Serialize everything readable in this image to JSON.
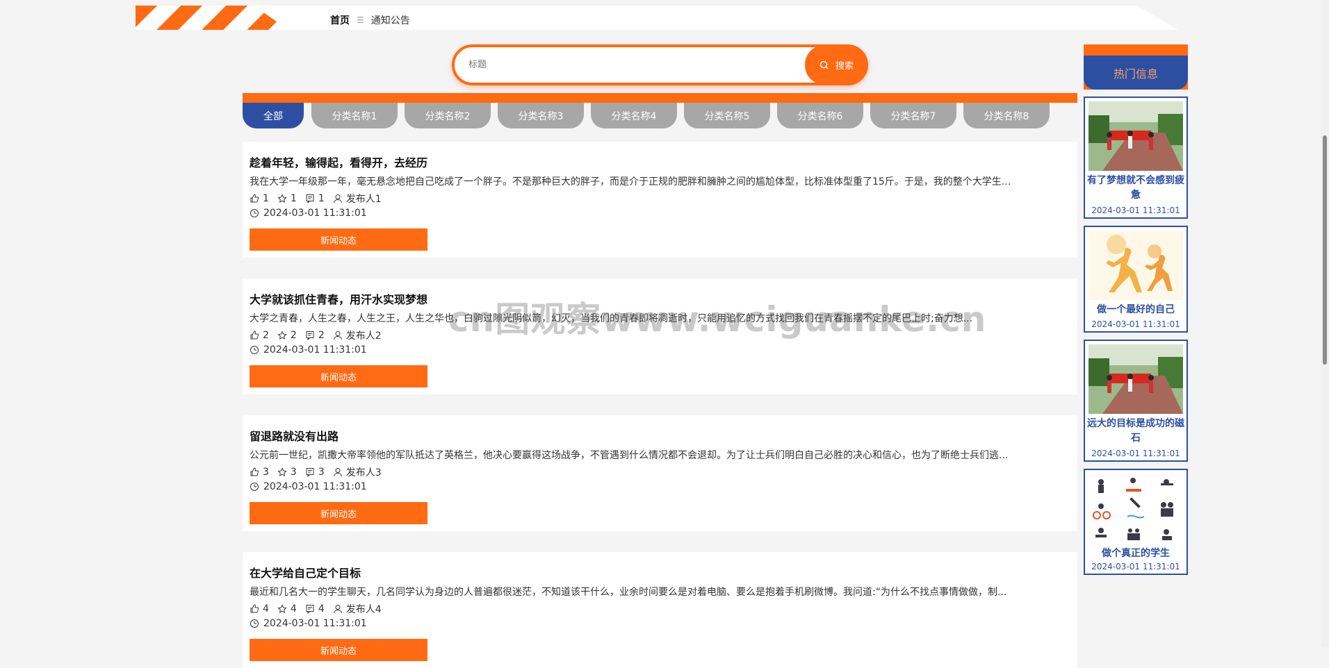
{
  "breadcrumb": {
    "home": "首页",
    "separator": "☰",
    "current": "通知公告"
  },
  "search": {
    "placeholder": "标题",
    "button_label": "搜索"
  },
  "categories": [
    "全部",
    "分类名称1",
    "分类名称2",
    "分类名称3",
    "分类名称4",
    "分类名称5",
    "分类名称6",
    "分类名称7",
    "分类名称8"
  ],
  "articles": [
    {
      "title": "趁着年轻，输得起，看得开，去经历",
      "excerpt": "我在大学一年级那一年，毫无悬念地把自己吃成了一个胖子。不是那种巨大的胖子，而是介于正规的肥胖和臃肿之间的尴尬体型，比标准体型重了15斤。于是，我的整个大学生...",
      "likes": "1",
      "favorites": "1",
      "comments": "1",
      "publisher": "发布人1",
      "time": "2024-03-01 11:31:01",
      "tag": "新闻动态"
    },
    {
      "title": "大学就该抓住青春，用汗水实现梦想",
      "excerpt": "大学之青春，人生之春，人生之王，人生之华也，白驹过隙光阴似箭，幻灭，当我们的青春即将凋逝时，只能用追忆的方式找回我们在青春摇摆不定的尾巴上时;奋力想...",
      "likes": "2",
      "favorites": "2",
      "comments": "2",
      "publisher": "发布人2",
      "time": "2024-03-01 11:31:01",
      "tag": "新闻动态"
    },
    {
      "title": "留退路就没有出路",
      "excerpt": "公元前一世纪，凯撒大帝率领他的军队抵达了英格兰，他决心要赢得这场战争，不管遇到什么情况都不会退却。为了让士兵们明白自己必胜的决心和信心，也为了断绝士兵们逃...",
      "likes": "3",
      "favorites": "3",
      "comments": "3",
      "publisher": "发布人3",
      "time": "2024-03-01 11:31:01",
      "tag": "新闻动态"
    },
    {
      "title": "在大学给自己定个目标",
      "excerpt": "最近和几名大一的学生聊天，几名同学认为身边的人普遍都很迷茫，不知道该干什么，业余时间要么是对着电脑、要么是抱着手机刷微博。我问道:“为什么不找点事情做做，制...",
      "likes": "4",
      "favorites": "4",
      "comments": "4",
      "publisher": "发布人4",
      "time": "2024-03-01 11:31:01",
      "tag": "新闻动态"
    }
  ],
  "hot": {
    "title": "热门信息",
    "items": [
      {
        "title": "有了梦想就不会感到疲惫",
        "date": "2024-03-01 11:31:01",
        "image": "parade-photo"
      },
      {
        "title": "做一个最好的自己",
        "date": "2024-03-01 11:31:01",
        "image": "running-silhouette"
      },
      {
        "title": "远大的目标是成功的磁石",
        "date": "2024-03-01 11:31:01",
        "image": "parade-photo"
      },
      {
        "title": "做个真正的学生",
        "date": "2024-03-01 11:31:01",
        "image": "sports-pictograms"
      }
    ]
  },
  "watermark": "cn图观察www.wciguanke.cn",
  "colors": {
    "accent": "#ff6a13",
    "primary": "#2d4fa1",
    "tab_inactive": "#a7a7a7",
    "background": "#f4f4f5"
  }
}
